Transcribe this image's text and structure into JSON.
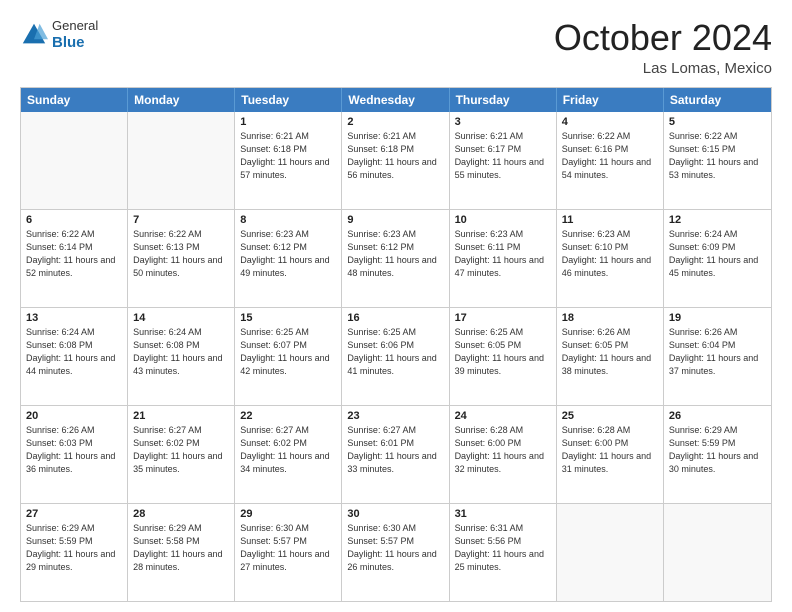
{
  "header": {
    "logo": {
      "general": "General",
      "blue": "Blue"
    },
    "title": "October 2024",
    "location": "Las Lomas, Mexico"
  },
  "days_of_week": [
    "Sunday",
    "Monday",
    "Tuesday",
    "Wednesday",
    "Thursday",
    "Friday",
    "Saturday"
  ],
  "weeks": [
    [
      {
        "day": null,
        "sunrise": null,
        "sunset": null,
        "daylight": null
      },
      {
        "day": null,
        "sunrise": null,
        "sunset": null,
        "daylight": null
      },
      {
        "day": "1",
        "sunrise": "Sunrise: 6:21 AM",
        "sunset": "Sunset: 6:18 PM",
        "daylight": "Daylight: 11 hours and 57 minutes."
      },
      {
        "day": "2",
        "sunrise": "Sunrise: 6:21 AM",
        "sunset": "Sunset: 6:18 PM",
        "daylight": "Daylight: 11 hours and 56 minutes."
      },
      {
        "day": "3",
        "sunrise": "Sunrise: 6:21 AM",
        "sunset": "Sunset: 6:17 PM",
        "daylight": "Daylight: 11 hours and 55 minutes."
      },
      {
        "day": "4",
        "sunrise": "Sunrise: 6:22 AM",
        "sunset": "Sunset: 6:16 PM",
        "daylight": "Daylight: 11 hours and 54 minutes."
      },
      {
        "day": "5",
        "sunrise": "Sunrise: 6:22 AM",
        "sunset": "Sunset: 6:15 PM",
        "daylight": "Daylight: 11 hours and 53 minutes."
      }
    ],
    [
      {
        "day": "6",
        "sunrise": "Sunrise: 6:22 AM",
        "sunset": "Sunset: 6:14 PM",
        "daylight": "Daylight: 11 hours and 52 minutes."
      },
      {
        "day": "7",
        "sunrise": "Sunrise: 6:22 AM",
        "sunset": "Sunset: 6:13 PM",
        "daylight": "Daylight: 11 hours and 50 minutes."
      },
      {
        "day": "8",
        "sunrise": "Sunrise: 6:23 AM",
        "sunset": "Sunset: 6:12 PM",
        "daylight": "Daylight: 11 hours and 49 minutes."
      },
      {
        "day": "9",
        "sunrise": "Sunrise: 6:23 AM",
        "sunset": "Sunset: 6:12 PM",
        "daylight": "Daylight: 11 hours and 48 minutes."
      },
      {
        "day": "10",
        "sunrise": "Sunrise: 6:23 AM",
        "sunset": "Sunset: 6:11 PM",
        "daylight": "Daylight: 11 hours and 47 minutes."
      },
      {
        "day": "11",
        "sunrise": "Sunrise: 6:23 AM",
        "sunset": "Sunset: 6:10 PM",
        "daylight": "Daylight: 11 hours and 46 minutes."
      },
      {
        "day": "12",
        "sunrise": "Sunrise: 6:24 AM",
        "sunset": "Sunset: 6:09 PM",
        "daylight": "Daylight: 11 hours and 45 minutes."
      }
    ],
    [
      {
        "day": "13",
        "sunrise": "Sunrise: 6:24 AM",
        "sunset": "Sunset: 6:08 PM",
        "daylight": "Daylight: 11 hours and 44 minutes."
      },
      {
        "day": "14",
        "sunrise": "Sunrise: 6:24 AM",
        "sunset": "Sunset: 6:08 PM",
        "daylight": "Daylight: 11 hours and 43 minutes."
      },
      {
        "day": "15",
        "sunrise": "Sunrise: 6:25 AM",
        "sunset": "Sunset: 6:07 PM",
        "daylight": "Daylight: 11 hours and 42 minutes."
      },
      {
        "day": "16",
        "sunrise": "Sunrise: 6:25 AM",
        "sunset": "Sunset: 6:06 PM",
        "daylight": "Daylight: 11 hours and 41 minutes."
      },
      {
        "day": "17",
        "sunrise": "Sunrise: 6:25 AM",
        "sunset": "Sunset: 6:05 PM",
        "daylight": "Daylight: 11 hours and 39 minutes."
      },
      {
        "day": "18",
        "sunrise": "Sunrise: 6:26 AM",
        "sunset": "Sunset: 6:05 PM",
        "daylight": "Daylight: 11 hours and 38 minutes."
      },
      {
        "day": "19",
        "sunrise": "Sunrise: 6:26 AM",
        "sunset": "Sunset: 6:04 PM",
        "daylight": "Daylight: 11 hours and 37 minutes."
      }
    ],
    [
      {
        "day": "20",
        "sunrise": "Sunrise: 6:26 AM",
        "sunset": "Sunset: 6:03 PM",
        "daylight": "Daylight: 11 hours and 36 minutes."
      },
      {
        "day": "21",
        "sunrise": "Sunrise: 6:27 AM",
        "sunset": "Sunset: 6:02 PM",
        "daylight": "Daylight: 11 hours and 35 minutes."
      },
      {
        "day": "22",
        "sunrise": "Sunrise: 6:27 AM",
        "sunset": "Sunset: 6:02 PM",
        "daylight": "Daylight: 11 hours and 34 minutes."
      },
      {
        "day": "23",
        "sunrise": "Sunrise: 6:27 AM",
        "sunset": "Sunset: 6:01 PM",
        "daylight": "Daylight: 11 hours and 33 minutes."
      },
      {
        "day": "24",
        "sunrise": "Sunrise: 6:28 AM",
        "sunset": "Sunset: 6:00 PM",
        "daylight": "Daylight: 11 hours and 32 minutes."
      },
      {
        "day": "25",
        "sunrise": "Sunrise: 6:28 AM",
        "sunset": "Sunset: 6:00 PM",
        "daylight": "Daylight: 11 hours and 31 minutes."
      },
      {
        "day": "26",
        "sunrise": "Sunrise: 6:29 AM",
        "sunset": "Sunset: 5:59 PM",
        "daylight": "Daylight: 11 hours and 30 minutes."
      }
    ],
    [
      {
        "day": "27",
        "sunrise": "Sunrise: 6:29 AM",
        "sunset": "Sunset: 5:59 PM",
        "daylight": "Daylight: 11 hours and 29 minutes."
      },
      {
        "day": "28",
        "sunrise": "Sunrise: 6:29 AM",
        "sunset": "Sunset: 5:58 PM",
        "daylight": "Daylight: 11 hours and 28 minutes."
      },
      {
        "day": "29",
        "sunrise": "Sunrise: 6:30 AM",
        "sunset": "Sunset: 5:57 PM",
        "daylight": "Daylight: 11 hours and 27 minutes."
      },
      {
        "day": "30",
        "sunrise": "Sunrise: 6:30 AM",
        "sunset": "Sunset: 5:57 PM",
        "daylight": "Daylight: 11 hours and 26 minutes."
      },
      {
        "day": "31",
        "sunrise": "Sunrise: 6:31 AM",
        "sunset": "Sunset: 5:56 PM",
        "daylight": "Daylight: 11 hours and 25 minutes."
      },
      {
        "day": null,
        "sunrise": null,
        "sunset": null,
        "daylight": null
      },
      {
        "day": null,
        "sunrise": null,
        "sunset": null,
        "daylight": null
      }
    ]
  ]
}
